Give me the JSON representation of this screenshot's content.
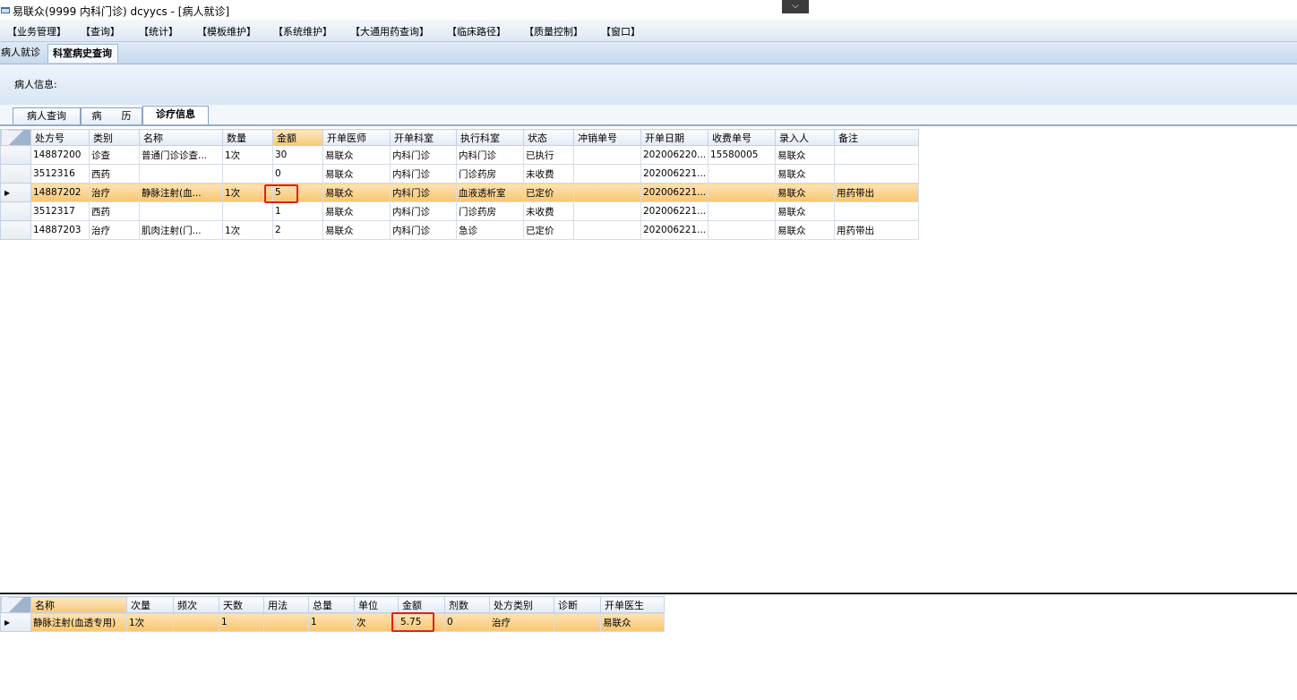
{
  "window": {
    "title": "易联众(9999 内科门诊) dcyycs - [病人就诊]",
    "dropdown_glyph": "⌵"
  },
  "menu": [
    "【业务管理】",
    "【查询】",
    "【统计】",
    "【模板维护】",
    "【系统维护】",
    "【大通用药查询】",
    "【临床路径】",
    "【质量控制】",
    "【窗口】"
  ],
  "doc_tabs": [
    "病人就诊",
    "科室病史查询"
  ],
  "patient_info_label": "病人信息:",
  "sub_tabs": [
    "病人查询",
    "病　　历",
    "诊疗信息"
  ],
  "main_grid": {
    "columns": [
      "处方号",
      "类别",
      "名称",
      "数量",
      "金额",
      "开单医师",
      "开单科室",
      "执行科室",
      "状态",
      "冲销单号",
      "开单日期",
      "收费单号",
      "录入人",
      "备注"
    ],
    "rows": [
      [
        "14887200",
        "诊查",
        "普通门诊诊查...",
        "1次",
        "30",
        "易联众",
        "内科门诊",
        "内科门诊",
        "已执行",
        "",
        "202006220...",
        "15580005",
        "易联众",
        ""
      ],
      [
        "3512316",
        "西药",
        "",
        "",
        "0",
        "易联众",
        "内科门诊",
        "门诊药房",
        "未收费",
        "",
        "202006221...",
        "",
        "易联众",
        ""
      ],
      [
        "14887202",
        "治疗",
        "静脉注射(血...",
        "1次",
        "5",
        "易联众",
        "内科门诊",
        "血液透析室",
        "已定价",
        "",
        "202006221...",
        "",
        "易联众",
        "用药带出"
      ],
      [
        "3512317",
        "西药",
        "",
        "",
        "1",
        "易联众",
        "内科门诊",
        "门诊药房",
        "未收费",
        "",
        "202006221...",
        "",
        "易联众",
        ""
      ],
      [
        "14887203",
        "治疗",
        "肌肉注射(门...",
        "1次",
        "2",
        "易联众",
        "内科门诊",
        "急诊",
        "已定价",
        "",
        "202006221...",
        "",
        "易联众",
        "用药带出"
      ]
    ],
    "selected_row": 2,
    "sorted_column": "金额"
  },
  "detail_grid": {
    "columns": [
      "名称",
      "次量",
      "频次",
      "天数",
      "用法",
      "总量",
      "单位",
      "金额",
      "剂数",
      "处方类别",
      "诊断",
      "开单医生"
    ],
    "rows": [
      [
        "静脉注射(血透专用)",
        "1次",
        "",
        "1",
        "",
        "1",
        "次",
        "5.75",
        "0",
        "治疗",
        "",
        "易联众"
      ]
    ]
  },
  "colors": {
    "selected_row": "#f8c670",
    "highlight_box": "#e0201c",
    "header_sorted": "#f8c876"
  },
  "icons": {
    "row_indicator": "triangle-right-icon",
    "app": "app-window-icon"
  }
}
